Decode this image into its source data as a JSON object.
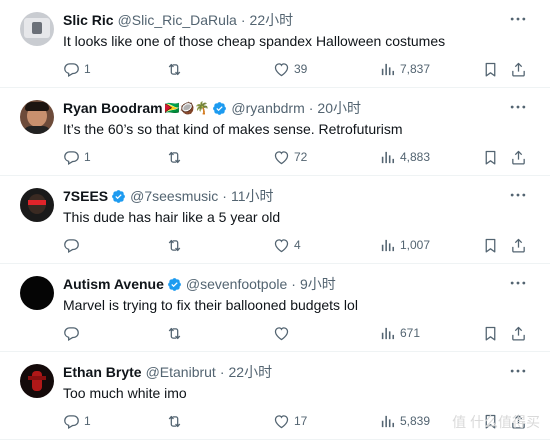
{
  "tweets": [
    {
      "name": "Slic Ric",
      "handle": "@Slic_Ric_DaRula",
      "time": "22小时",
      "text": "It looks like one of those cheap spandex Halloween costumes",
      "emoji": "",
      "verified": false,
      "replies": "1",
      "retweets": "",
      "likes": "39",
      "views": "7,837",
      "avatar_color": "#c9ccd1"
    },
    {
      "name": "Ryan Boodram",
      "handle": "@ryanbdrm",
      "time": "20小时",
      "text": "It’s the 60’s so that kind of makes sense. Retrofuturism",
      "emoji": "🇬🇾🥥🌴",
      "verified": true,
      "replies": "1",
      "retweets": "",
      "likes": "72",
      "views": "4,883",
      "avatar_color": "#6d4b3a"
    },
    {
      "name": "7SEES",
      "handle": "@7seesmusic",
      "time": "11小时",
      "text": "This dude has hair like a 5 year old",
      "emoji": "",
      "verified": true,
      "replies": "",
      "retweets": "",
      "likes": "4",
      "views": "1,007",
      "avatar_color": "#1a1a1a"
    },
    {
      "name": "Autism Avenue",
      "handle": "@sevenfootpole",
      "time": "9小时",
      "text": "Marvel is trying to fix their ballooned budgets lol",
      "emoji": "",
      "verified": true,
      "replies": "",
      "retweets": "",
      "likes": "",
      "views": "671",
      "avatar_color": "#050505"
    },
    {
      "name": "Ethan Bryte",
      "handle": "@Etanibrut",
      "time": "22小时",
      "text": "Too much white imo",
      "emoji": "",
      "verified": false,
      "replies": "1",
      "retweets": "",
      "likes": "17",
      "views": "5,839",
      "avatar_color": "#140a0a"
    }
  ],
  "separator": "·",
  "watermark": "值 什么值得买",
  "colors": {
    "text": "#0f1419",
    "secondary": "#536471",
    "verified": "#1d9bf0",
    "divider": "#eff3f4"
  }
}
